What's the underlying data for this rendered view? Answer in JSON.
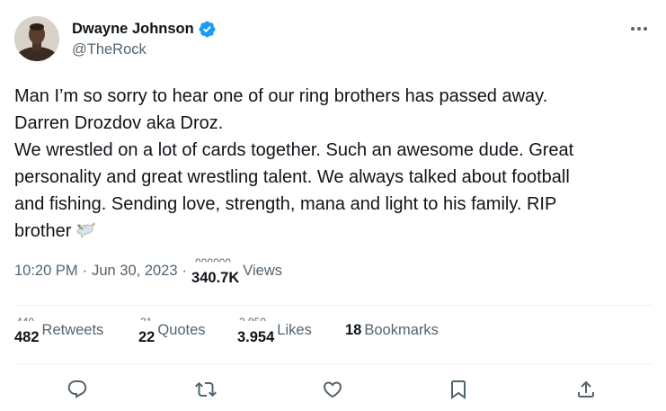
{
  "author": {
    "display_name": "Dwayne Johnson",
    "handle": "@TheRock",
    "verified": true,
    "verified_color": "#1d9bf0"
  },
  "tweet": {
    "lines": [
      "Man I’m so sorry to hear one of our ring brothers has passed away.",
      "Darren Drozdov aka Droz.",
      "We wrestled on a lot of cards together. Such an awesome dude. Great",
      "personality and great wrestling talent. We always talked about football",
      "and fishing. Sending love, strength, mana and light to his family.  RIP",
      "brother"
    ],
    "emoji": "dove"
  },
  "meta": {
    "time": "10:20 PM",
    "separator": "·",
    "date": "Jun 30, 2023",
    "views_count": "340.7K",
    "views_label": "Views"
  },
  "stats": {
    "retweets": {
      "count": "482",
      "label": "Retweets"
    },
    "quotes": {
      "count": "22",
      "label": "Quotes"
    },
    "likes": {
      "count": "3.954",
      "label": "Likes"
    },
    "bookmarks": {
      "count": "18",
      "label": "Bookmarks"
    }
  },
  "actions": [
    {
      "name": "reply",
      "icon": "reply-icon"
    },
    {
      "name": "retweet",
      "icon": "retweet-icon"
    },
    {
      "name": "like",
      "icon": "heart-icon"
    },
    {
      "name": "bookmark",
      "icon": "bookmark-icon"
    },
    {
      "name": "share",
      "icon": "share-icon"
    }
  ],
  "colors": {
    "text_primary": "#0f1419",
    "text_secondary": "#536471",
    "divider": "#eff3f4",
    "accent": "#1d9bf0"
  }
}
